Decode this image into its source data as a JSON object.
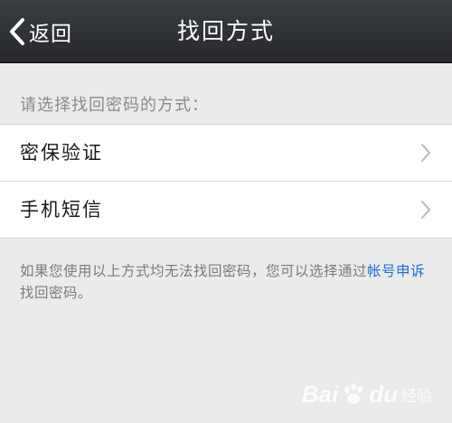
{
  "navbar": {
    "back_label": "返回",
    "title": "找回方式"
  },
  "section_hint": "请选择找回密码的方式：",
  "options": [
    {
      "label": "密保验证"
    },
    {
      "label": "手机短信"
    }
  ],
  "footer": {
    "text_before": "如果您使用以上方式均无法找回密码，您可以选择通过",
    "link_text": "帐号申诉",
    "text_after": "找回密码。"
  },
  "watermark": {
    "bai": "Bai",
    "du": "du",
    "jingyan": "经验"
  },
  "colors": {
    "navbar_bg": "#2c2e32",
    "page_bg": "#ebebeb",
    "link": "#1a6fd0",
    "hint_text": "#8a8a8a"
  }
}
